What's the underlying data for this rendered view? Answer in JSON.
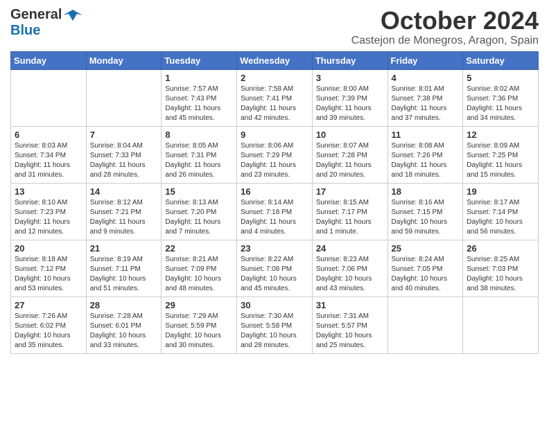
{
  "header": {
    "logo_line1": "General",
    "logo_line2": "Blue",
    "month": "October 2024",
    "location": "Castejon de Monegros, Aragon, Spain"
  },
  "days_of_week": [
    "Sunday",
    "Monday",
    "Tuesday",
    "Wednesday",
    "Thursday",
    "Friday",
    "Saturday"
  ],
  "weeks": [
    [
      {
        "day": "",
        "info": ""
      },
      {
        "day": "",
        "info": ""
      },
      {
        "day": "1",
        "info": "Sunrise: 7:57 AM\nSunset: 7:43 PM\nDaylight: 11 hours\nand 45 minutes."
      },
      {
        "day": "2",
        "info": "Sunrise: 7:58 AM\nSunset: 7:41 PM\nDaylight: 11 hours\nand 42 minutes."
      },
      {
        "day": "3",
        "info": "Sunrise: 8:00 AM\nSunset: 7:39 PM\nDaylight: 11 hours\nand 39 minutes."
      },
      {
        "day": "4",
        "info": "Sunrise: 8:01 AM\nSunset: 7:38 PM\nDaylight: 11 hours\nand 37 minutes."
      },
      {
        "day": "5",
        "info": "Sunrise: 8:02 AM\nSunset: 7:36 PM\nDaylight: 11 hours\nand 34 minutes."
      }
    ],
    [
      {
        "day": "6",
        "info": "Sunrise: 8:03 AM\nSunset: 7:34 PM\nDaylight: 11 hours\nand 31 minutes."
      },
      {
        "day": "7",
        "info": "Sunrise: 8:04 AM\nSunset: 7:33 PM\nDaylight: 11 hours\nand 28 minutes."
      },
      {
        "day": "8",
        "info": "Sunrise: 8:05 AM\nSunset: 7:31 PM\nDaylight: 11 hours\nand 26 minutes."
      },
      {
        "day": "9",
        "info": "Sunrise: 8:06 AM\nSunset: 7:29 PM\nDaylight: 11 hours\nand 23 minutes."
      },
      {
        "day": "10",
        "info": "Sunrise: 8:07 AM\nSunset: 7:28 PM\nDaylight: 11 hours\nand 20 minutes."
      },
      {
        "day": "11",
        "info": "Sunrise: 8:08 AM\nSunset: 7:26 PM\nDaylight: 11 hours\nand 18 minutes."
      },
      {
        "day": "12",
        "info": "Sunrise: 8:09 AM\nSunset: 7:25 PM\nDaylight: 11 hours\nand 15 minutes."
      }
    ],
    [
      {
        "day": "13",
        "info": "Sunrise: 8:10 AM\nSunset: 7:23 PM\nDaylight: 11 hours\nand 12 minutes."
      },
      {
        "day": "14",
        "info": "Sunrise: 8:12 AM\nSunset: 7:21 PM\nDaylight: 11 hours\nand 9 minutes."
      },
      {
        "day": "15",
        "info": "Sunrise: 8:13 AM\nSunset: 7:20 PM\nDaylight: 11 hours\nand 7 minutes."
      },
      {
        "day": "16",
        "info": "Sunrise: 8:14 AM\nSunset: 7:18 PM\nDaylight: 11 hours\nand 4 minutes."
      },
      {
        "day": "17",
        "info": "Sunrise: 8:15 AM\nSunset: 7:17 PM\nDaylight: 11 hours\nand 1 minute."
      },
      {
        "day": "18",
        "info": "Sunrise: 8:16 AM\nSunset: 7:15 PM\nDaylight: 10 hours\nand 59 minutes."
      },
      {
        "day": "19",
        "info": "Sunrise: 8:17 AM\nSunset: 7:14 PM\nDaylight: 10 hours\nand 56 minutes."
      }
    ],
    [
      {
        "day": "20",
        "info": "Sunrise: 8:18 AM\nSunset: 7:12 PM\nDaylight: 10 hours\nand 53 minutes."
      },
      {
        "day": "21",
        "info": "Sunrise: 8:19 AM\nSunset: 7:11 PM\nDaylight: 10 hours\nand 51 minutes."
      },
      {
        "day": "22",
        "info": "Sunrise: 8:21 AM\nSunset: 7:09 PM\nDaylight: 10 hours\nand 48 minutes."
      },
      {
        "day": "23",
        "info": "Sunrise: 8:22 AM\nSunset: 7:08 PM\nDaylight: 10 hours\nand 45 minutes."
      },
      {
        "day": "24",
        "info": "Sunrise: 8:23 AM\nSunset: 7:06 PM\nDaylight: 10 hours\nand 43 minutes."
      },
      {
        "day": "25",
        "info": "Sunrise: 8:24 AM\nSunset: 7:05 PM\nDaylight: 10 hours\nand 40 minutes."
      },
      {
        "day": "26",
        "info": "Sunrise: 8:25 AM\nSunset: 7:03 PM\nDaylight: 10 hours\nand 38 minutes."
      }
    ],
    [
      {
        "day": "27",
        "info": "Sunrise: 7:26 AM\nSunset: 6:02 PM\nDaylight: 10 hours\nand 35 minutes."
      },
      {
        "day": "28",
        "info": "Sunrise: 7:28 AM\nSunset: 6:01 PM\nDaylight: 10 hours\nand 33 minutes."
      },
      {
        "day": "29",
        "info": "Sunrise: 7:29 AM\nSunset: 5:59 PM\nDaylight: 10 hours\nand 30 minutes."
      },
      {
        "day": "30",
        "info": "Sunrise: 7:30 AM\nSunset: 5:58 PM\nDaylight: 10 hours\nand 28 minutes."
      },
      {
        "day": "31",
        "info": "Sunrise: 7:31 AM\nSunset: 5:57 PM\nDaylight: 10 hours\nand 25 minutes."
      },
      {
        "day": "",
        "info": ""
      },
      {
        "day": "",
        "info": ""
      }
    ]
  ]
}
